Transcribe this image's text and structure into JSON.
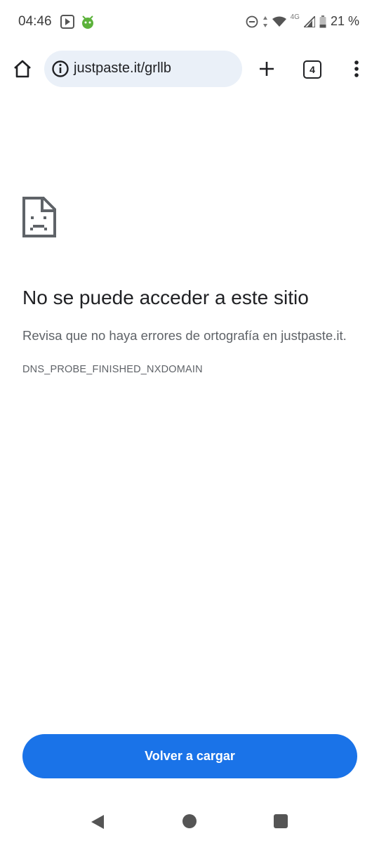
{
  "status_bar": {
    "time": "04:46",
    "network": "4G",
    "battery": "21 %"
  },
  "toolbar": {
    "url": "justpaste.it/grllb",
    "tab_count": "4"
  },
  "error": {
    "title": "No se puede acceder a este sitio",
    "description": "Revisa que no haya errores de ortografía en justpaste.it.",
    "code": "DNS_PROBE_FINISHED_NXDOMAIN"
  },
  "actions": {
    "reload_label": "Volver a cargar"
  },
  "colors": {
    "accent": "#1a73e8",
    "omnibox_bg": "#eaf0f8"
  },
  "icons": [
    "home-icon",
    "info-icon",
    "plus-icon",
    "tab-switcher-icon",
    "more-vert-icon",
    "sad-page-icon",
    "back-icon",
    "home-nav-icon",
    "recents-icon"
  ]
}
